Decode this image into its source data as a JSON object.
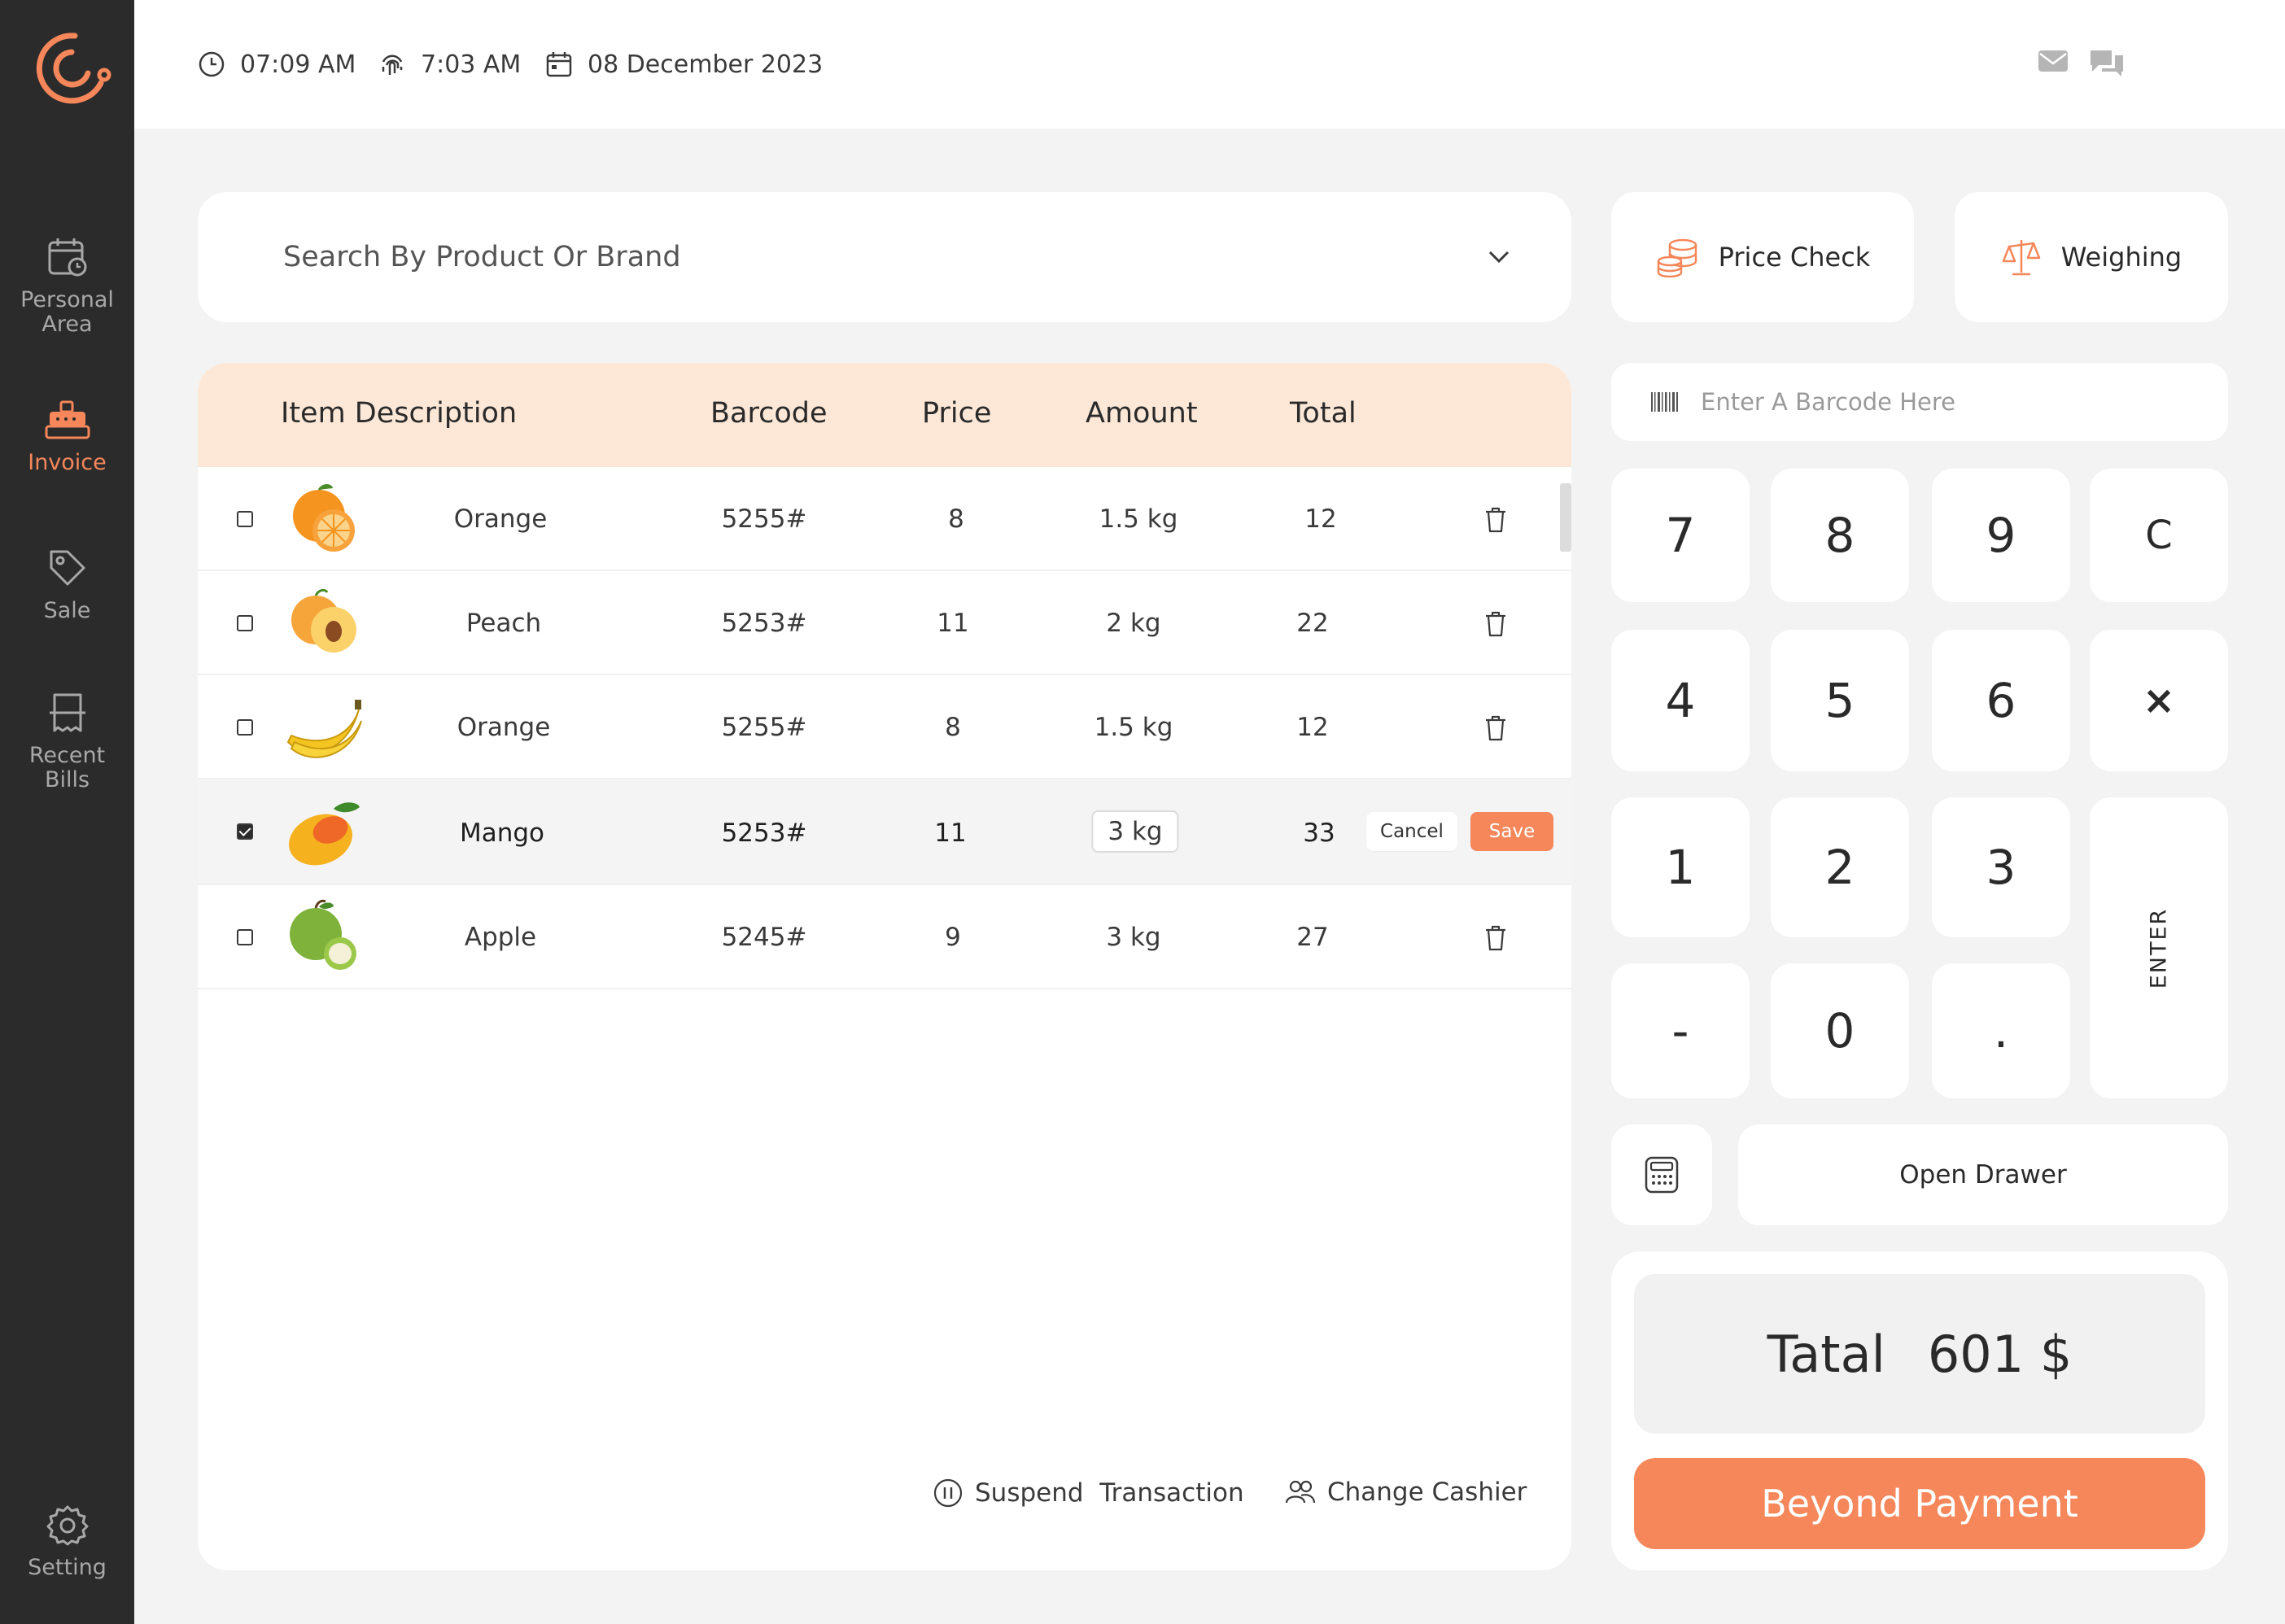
{
  "sidebar": {
    "items": [
      {
        "label": "Personal\nArea",
        "icon": "calendar-clock-icon",
        "active": false
      },
      {
        "label": "Invoice",
        "icon": "register-icon",
        "active": true
      },
      {
        "label": "Sale",
        "icon": "tag-icon",
        "active": false
      },
      {
        "label": "Recent\nBills",
        "icon": "receipt-icon",
        "active": false
      },
      {
        "label": "Setting",
        "icon": "gear-icon",
        "active": false
      }
    ]
  },
  "topbar": {
    "time": "07:09 AM",
    "clock_in": "7:03 AM",
    "date": "08 December 2023"
  },
  "search": {
    "placeholder": "Search By Product Or Brand"
  },
  "table": {
    "headers": {
      "description": "Item Description",
      "barcode": "Barcode",
      "price": "Price",
      "amount": "Amount",
      "total": "Total"
    },
    "rows": [
      {
        "name": "Orange",
        "barcode": "5255#",
        "price": "8",
        "amount": "1.5 kg",
        "total": "12",
        "fruit": "orange",
        "checked": false
      },
      {
        "name": "Peach",
        "barcode": "5253#",
        "price": "11",
        "amount": "2 kg",
        "total": "22",
        "fruit": "peach",
        "checked": false
      },
      {
        "name": "Orange",
        "barcode": "5255#",
        "price": "8",
        "amount": "1.5 kg",
        "total": "12",
        "fruit": "banana",
        "checked": false
      },
      {
        "name": "Mango",
        "barcode": "5253#",
        "price": "11",
        "amount": "3 kg",
        "total": "33",
        "fruit": "mango",
        "checked": true
      },
      {
        "name": "Apple",
        "barcode": "5245#",
        "price": "9",
        "amount": "3 kg",
        "total": "27",
        "fruit": "apple",
        "checked": false
      }
    ],
    "cancel_label": "Cancel",
    "save_label": "Save"
  },
  "footer": {
    "suspend_label": "Suspend  Transaction",
    "change_cashier_label": "Change Cashier"
  },
  "right": {
    "price_check_label": "Price Check",
    "weighing_label": "Weighing",
    "barcode_placeholder": "Enter A Barcode Here",
    "keys": {
      "k7": "7",
      "k8": "8",
      "k9": "9",
      "kc": "C",
      "k4": "4",
      "k5": "5",
      "k6": "6",
      "kx": "×",
      "k1": "1",
      "k2": "2",
      "k3": "3",
      "kenter": "ENTER",
      "kminus": "-",
      "k0": "0",
      "kdot": "."
    },
    "open_drawer_label": "Open Drawer",
    "total_label": "Tatal",
    "total_value": "601 $",
    "pay_label": "Beyond Payment"
  },
  "colors": {
    "accent": "#f5875a",
    "sidebar": "#2b2b2b",
    "header_row": "#fde8d7"
  }
}
